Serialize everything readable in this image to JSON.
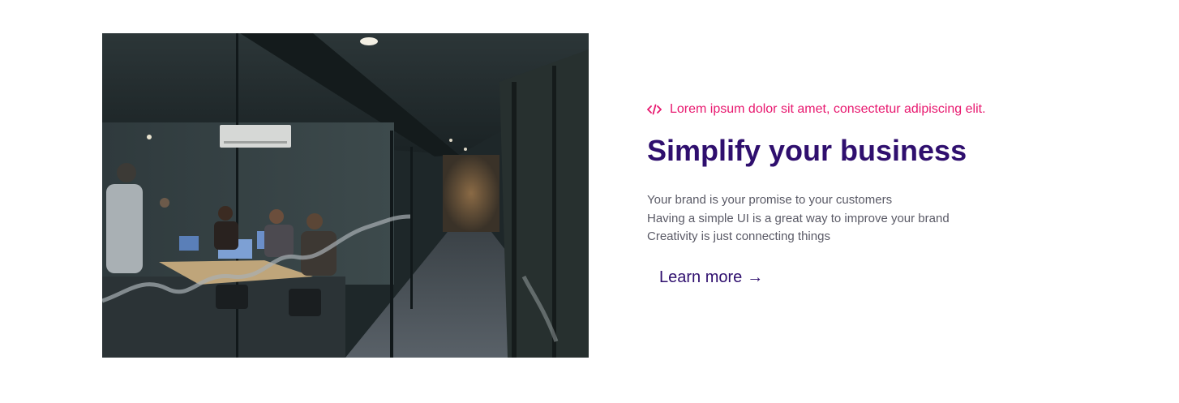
{
  "feature": {
    "eyebrow": "Lorem ipsum dolor sit amet, consectetur adipiscing elit.",
    "title": "Simplify your business",
    "description_lines": [
      "Your brand is your promise to your customers",
      "Having a simple UI is a great way to improve your brand",
      "Creativity is just connecting things"
    ],
    "cta_label": "Learn more",
    "cta_arrow": "→"
  },
  "icons": {
    "eyebrow_icon": "code-icon",
    "cta_icon": "arrow-right-icon"
  },
  "colors": {
    "accent": "#e8186f",
    "title": "#2f0f6e",
    "body_text": "#5a5a66",
    "background": "#ffffff"
  }
}
